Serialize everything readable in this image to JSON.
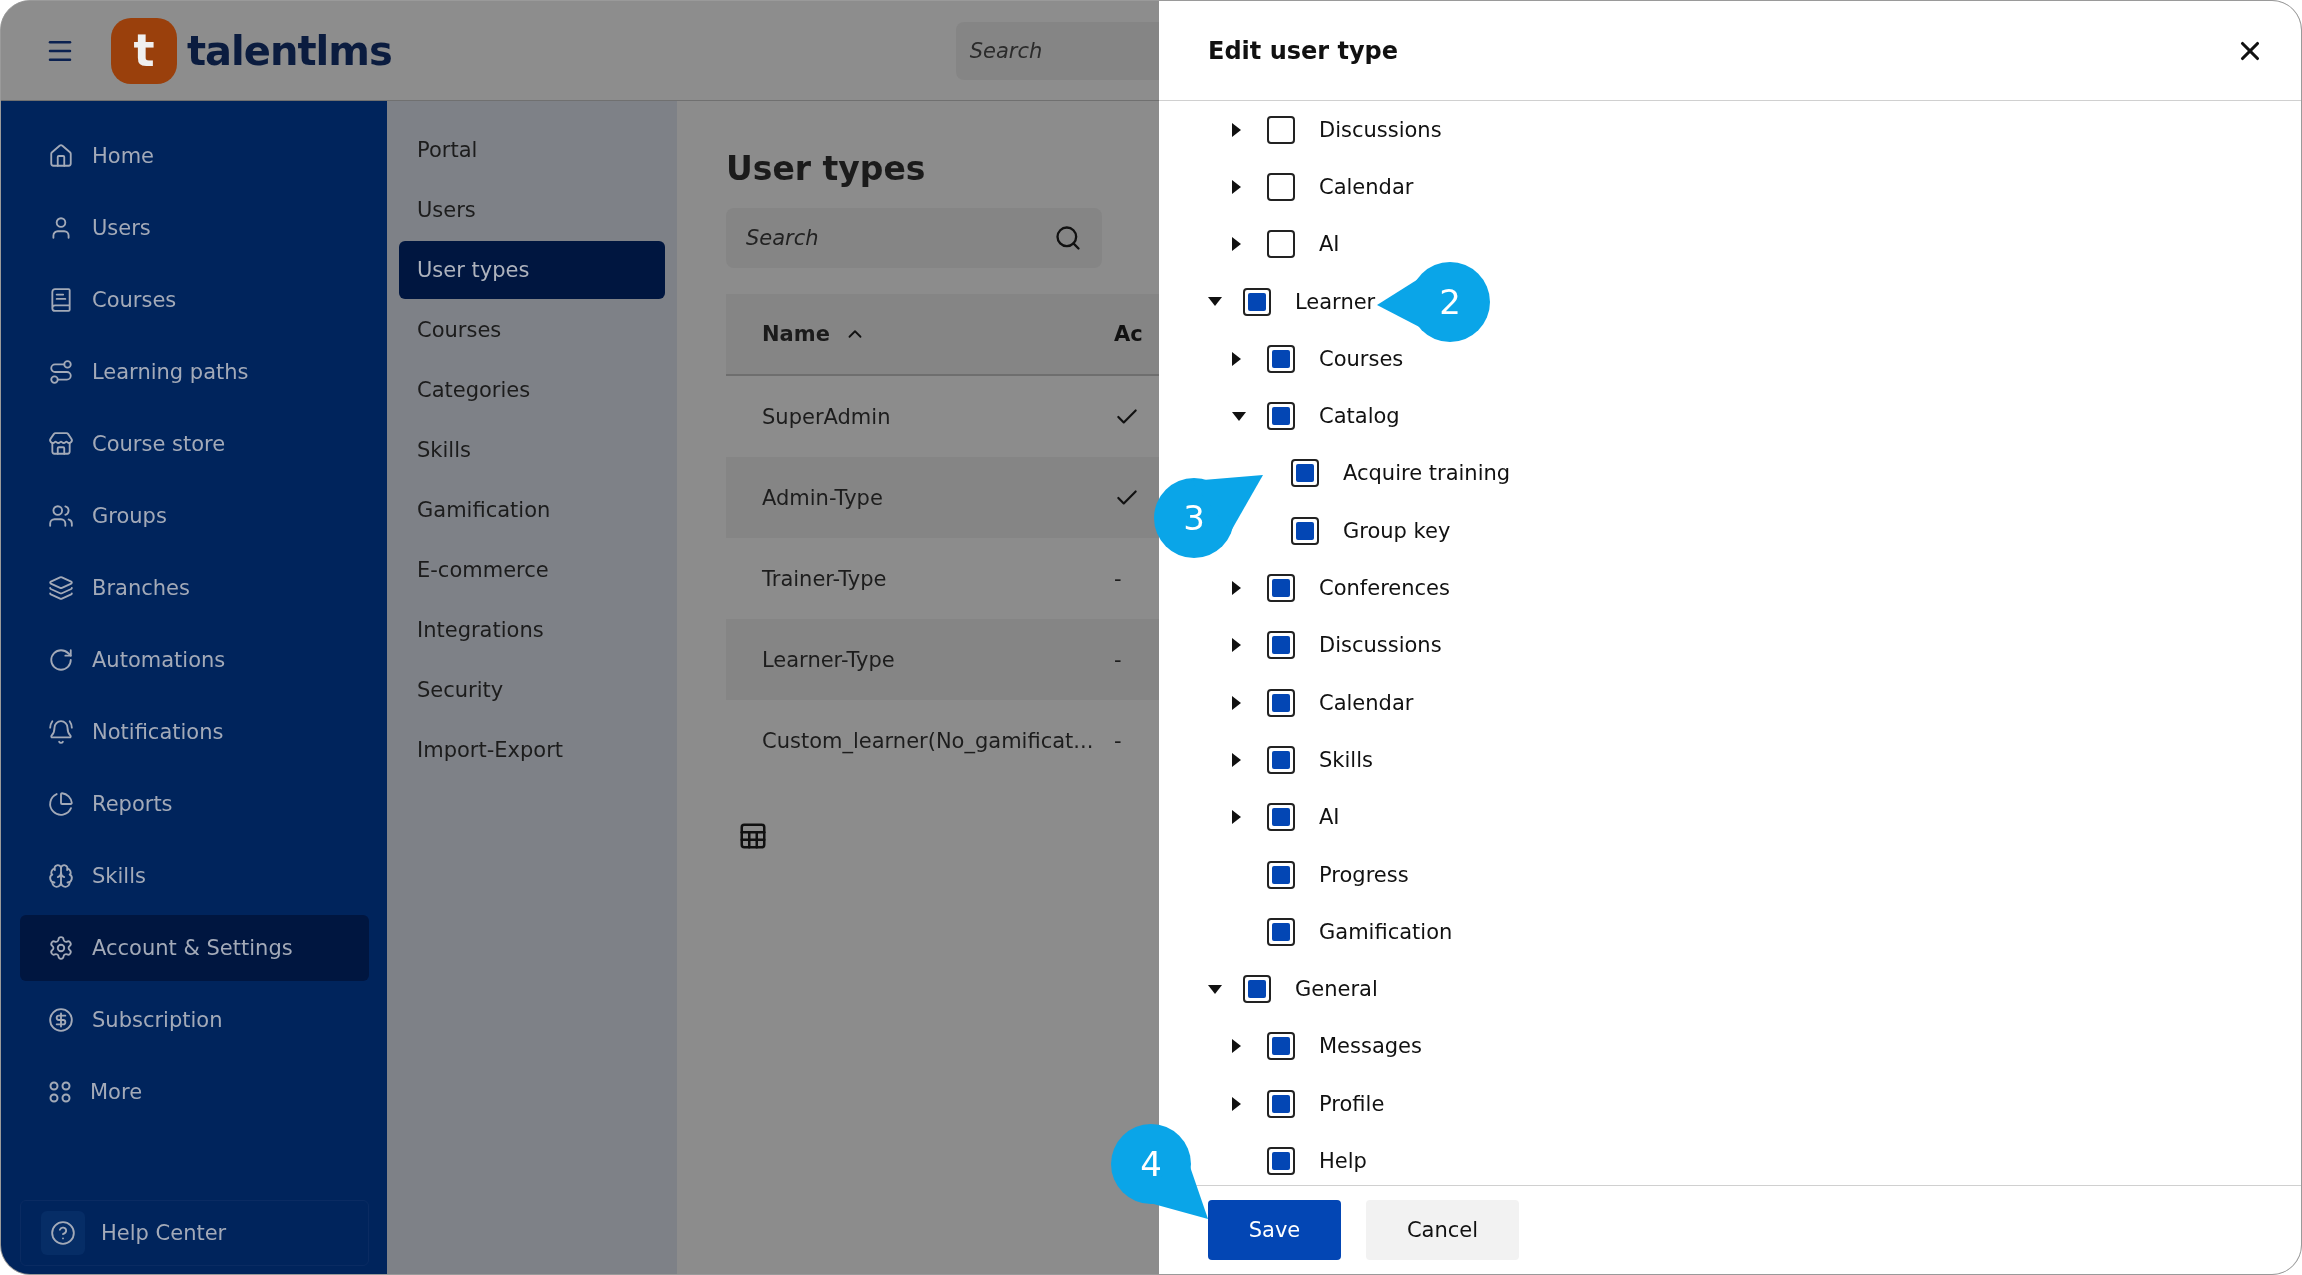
{
  "header": {
    "logo": {
      "mark": "t",
      "wordmark": "talentlms"
    },
    "search": {
      "placeholder": "Search"
    }
  },
  "sidebar": {
    "items": [
      {
        "label": "Home",
        "selected": false
      },
      {
        "label": "Users",
        "selected": false
      },
      {
        "label": "Courses",
        "selected": false
      },
      {
        "label": "Learning paths",
        "selected": false
      },
      {
        "label": "Course store",
        "selected": false
      },
      {
        "label": "Groups",
        "selected": false
      },
      {
        "label": "Branches",
        "selected": false
      },
      {
        "label": "Automations",
        "selected": false
      },
      {
        "label": "Notifications",
        "selected": false
      },
      {
        "label": "Reports",
        "selected": false
      },
      {
        "label": "Skills",
        "selected": false
      },
      {
        "label": "Account & Settings",
        "selected": true
      },
      {
        "label": "Subscription",
        "selected": false
      },
      {
        "label": "More",
        "selected": false
      }
    ],
    "help": {
      "label": "Help Center"
    }
  },
  "settings_menu": {
    "items": [
      {
        "label": "Portal",
        "selected": false
      },
      {
        "label": "Users",
        "selected": false
      },
      {
        "label": "User types",
        "selected": true
      },
      {
        "label": "Courses",
        "selected": false
      },
      {
        "label": "Categories",
        "selected": false
      },
      {
        "label": "Skills",
        "selected": false
      },
      {
        "label": "Gamification",
        "selected": false
      },
      {
        "label": "E-commerce",
        "selected": false
      },
      {
        "label": "Integrations",
        "selected": false
      },
      {
        "label": "Security",
        "selected": false
      },
      {
        "label": "Import-Export",
        "selected": false
      }
    ]
  },
  "main": {
    "title": "User types",
    "search": {
      "placeholder": "Search"
    },
    "table": {
      "columns": [
        "Name",
        "Ac"
      ],
      "rows": [
        {
          "name": "SuperAdmin",
          "column_2": {
            "kind": "check"
          }
        },
        {
          "name": "Admin-Type",
          "column_2": {
            "kind": "check"
          }
        },
        {
          "name": "Trainer-Type",
          "column_2": {
            "kind": "text",
            "text": "-"
          }
        },
        {
          "name": "Learner-Type",
          "column_2": {
            "kind": "text",
            "text": "-"
          }
        },
        {
          "name": "Custom_learner(No_gamificat...",
          "column_2": {
            "kind": "text",
            "text": "-"
          }
        }
      ]
    }
  },
  "modal": {
    "title": "Edit user type",
    "tree_continued": [
      {
        "label": "Discussions",
        "checked": false,
        "expanded": false
      },
      {
        "label": "Calendar",
        "checked": false,
        "expanded": false
      },
      {
        "label": "AI",
        "checked": false,
        "expanded": false
      }
    ],
    "tree": [
      {
        "label": "Learner",
        "checked": true,
        "expanded": true,
        "children": [
          {
            "label": "Courses",
            "checked": true,
            "expanded": false
          },
          {
            "label": "Catalog",
            "checked": true,
            "expanded": true,
            "children": [
              {
                "label": "Acquire training",
                "checked": true
              },
              {
                "label": "Group key",
                "checked": true
              }
            ]
          },
          {
            "label": "Conferences",
            "checked": true,
            "expanded": false
          },
          {
            "label": "Discussions",
            "checked": true,
            "expanded": false
          },
          {
            "label": "Calendar",
            "checked": true,
            "expanded": false
          },
          {
            "label": "Skills",
            "checked": true,
            "expanded": false
          },
          {
            "label": "AI",
            "checked": true,
            "expanded": false
          },
          {
            "label": "Progress",
            "checked": true
          },
          {
            "label": "Gamification",
            "checked": true
          }
        ]
      },
      {
        "label": "General",
        "checked": true,
        "expanded": true,
        "children": [
          {
            "label": "Messages",
            "checked": true,
            "expanded": false
          },
          {
            "label": "Profile",
            "checked": true,
            "expanded": false
          },
          {
            "label": "Help",
            "checked": true
          }
        ]
      }
    ],
    "buttons": {
      "save": "Save",
      "cancel": "Cancel"
    }
  },
  "callouts": [
    {
      "text": "2"
    },
    {
      "text": "3"
    },
    {
      "text": "4"
    }
  ]
}
